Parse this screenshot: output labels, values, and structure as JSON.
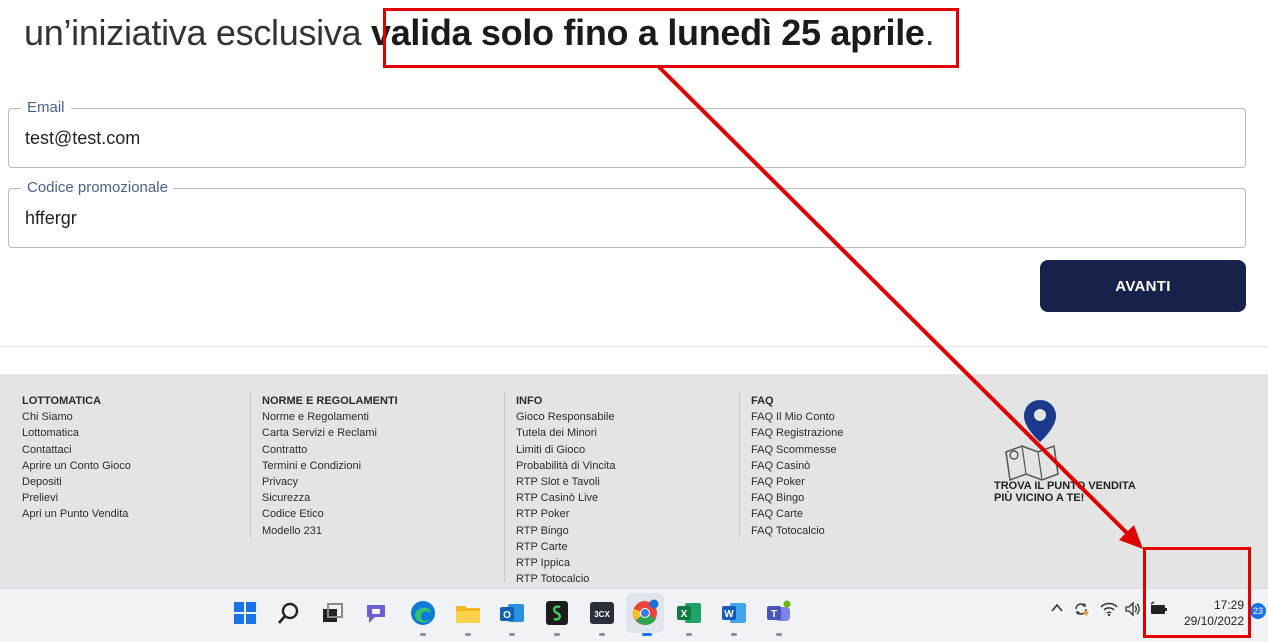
{
  "headline": {
    "prefix": "un’iniziativa esclusiva ",
    "bold": "valida solo fino a lunedì 25 aprile",
    "suffix": "."
  },
  "form": {
    "email_label": "Email",
    "email_value": "test@test.com",
    "promo_label": "Codice promozionale",
    "promo_value": "hffergr",
    "submit_label": "AVANTI"
  },
  "footer": {
    "lottomatica": {
      "heading": "LOTTOMATICA",
      "items": [
        "Chi Siamo",
        "Lottomatica",
        "Contattaci",
        "Aprire un Conto Gioco",
        "Depositi",
        "Prelievi",
        "Apri un Punto Vendita"
      ]
    },
    "norme": {
      "heading": "NORME E REGOLAMENTI",
      "items": [
        "Norme e Regolamenti",
        "Carta Servizi e Reclami",
        "Contratto",
        "Termini e Condizioni",
        "Privacy",
        "Sicurezza",
        "Codice Etico",
        "Modello 231"
      ]
    },
    "info": {
      "heading": "INFO",
      "items": [
        "Gioco Responsabile",
        "Tutela dei Minori",
        "Limiti di Gioco",
        "Probabilità di Vincita",
        "RTP Slot e Tavoli",
        "RTP Casinò Live",
        "RTP Poker",
        "RTP Bingo",
        "RTP Carte",
        "RTP Ippica",
        "RTP Totocalcio"
      ]
    },
    "faq": {
      "heading": "FAQ",
      "items": [
        "FAQ Il Mio Conto",
        "FAQ Registrazione",
        "FAQ Scommesse",
        "FAQ Casinò",
        "FAQ Poker",
        "FAQ Bingo",
        "FAQ Carte",
        "FAQ Totocalcio"
      ]
    },
    "store_locator": {
      "line1": "TROVA IL PUNTO VENDITA",
      "line2": "PIÙ VICINO A TE!"
    }
  },
  "taskbar": {
    "time": "17:29",
    "date": "29/10/2022",
    "notification_count": "23",
    "icons": [
      "windows-start-icon",
      "search-icon",
      "task-view-icon",
      "teams-chat-icon",
      "edge-icon",
      "file-explorer-icon",
      "outlook-icon",
      "app-s-icon",
      "3cx-icon",
      "chrome-icon",
      "excel-icon",
      "word-icon",
      "teams-icon"
    ],
    "tray_icons": [
      "chevron-up-icon",
      "sync-icon",
      "wifi-icon",
      "volume-icon",
      "battery-icon"
    ]
  },
  "annotation_color": "#e00000",
  "accent_color": "#17214a"
}
